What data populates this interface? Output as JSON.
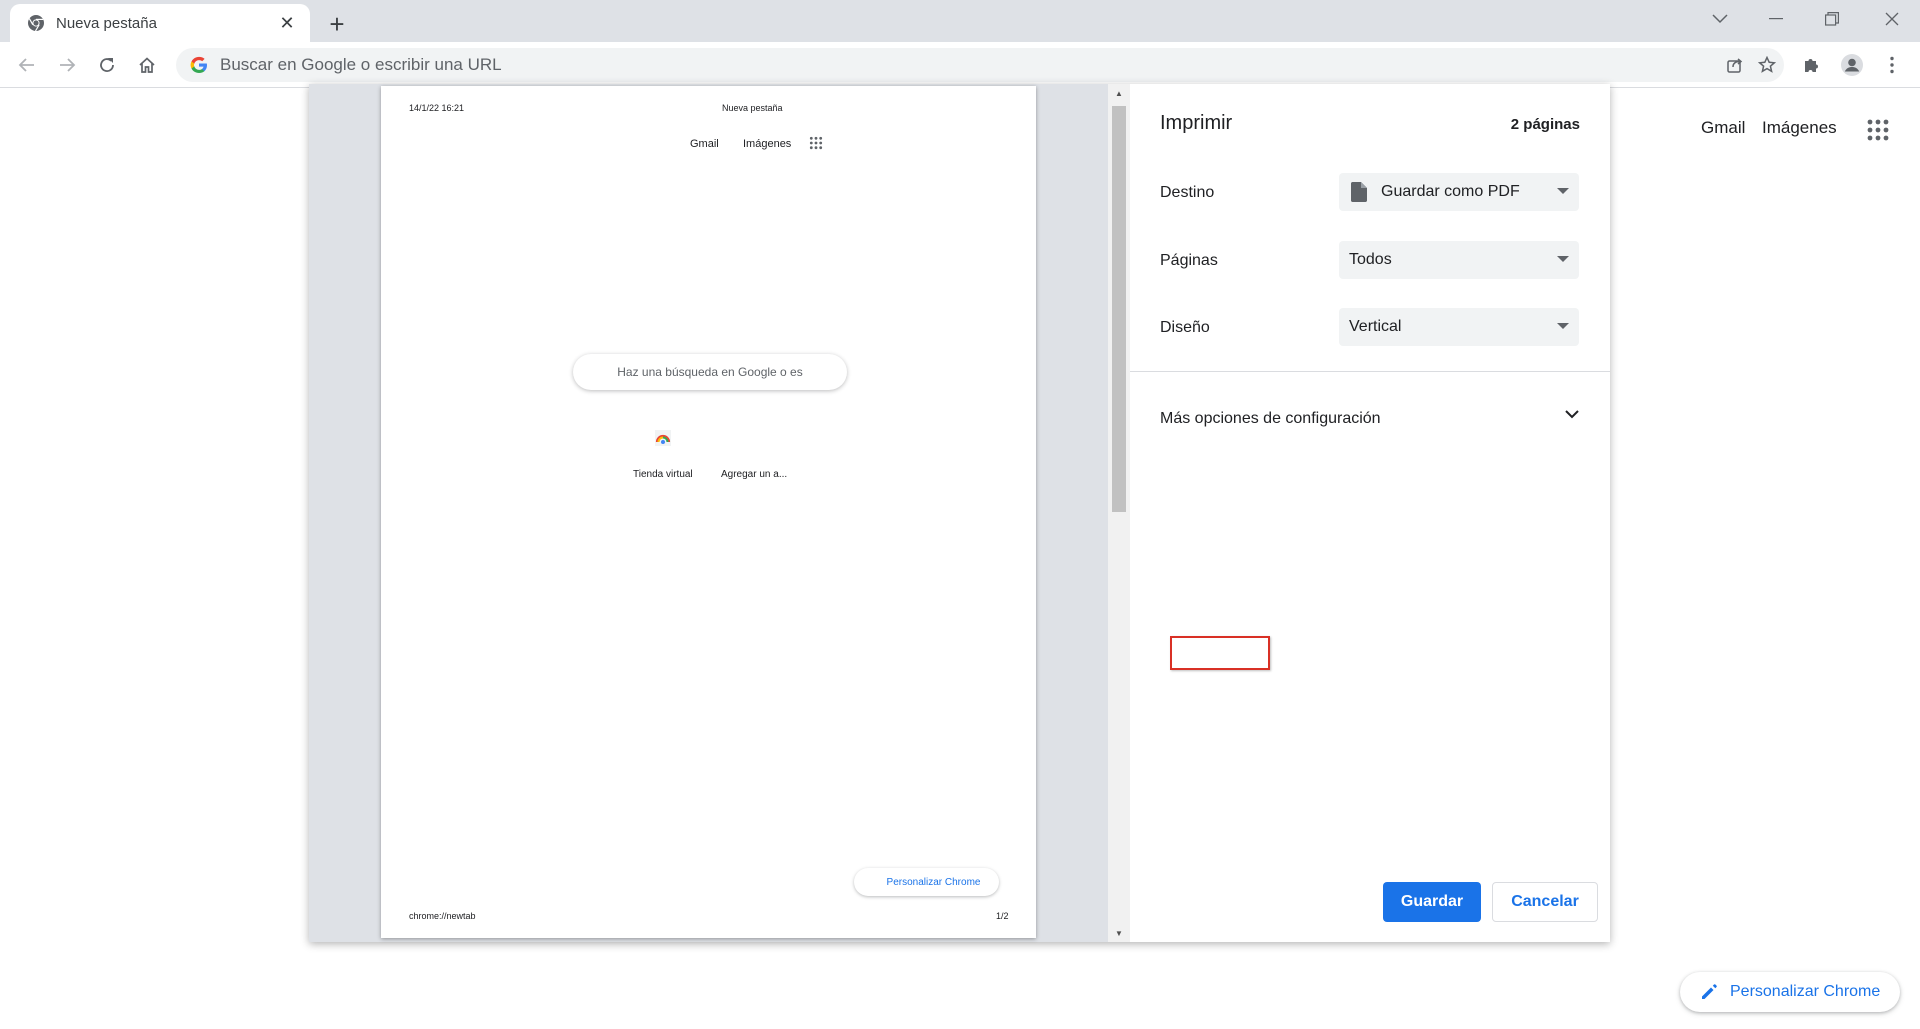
{
  "tab": {
    "title": "Nueva pestaña",
    "close_glyph": "✕",
    "new_tab_glyph": "+"
  },
  "omnibox": {
    "placeholder": "Buscar en Google o escribir una URL"
  },
  "background_page": {
    "gmail": "Gmail",
    "images": "Imágenes",
    "customize": "Personalizar Chrome"
  },
  "preview": {
    "header_date": "14/1/22 16:21",
    "header_title": "Nueva pestaña",
    "gmail": "Gmail",
    "images": "Imágenes",
    "search_placeholder": "Haz una búsqueda en Google o es",
    "shortcut_store": "Tienda virtual",
    "shortcut_add": "Agregar un a...",
    "customize": "Personalizar Chrome",
    "footer_url": "chrome://newtab",
    "footer_page": "1/2"
  },
  "print": {
    "title": "Imprimir",
    "page_count": "2 páginas",
    "destination_label": "Destino",
    "destination_value": "Guardar como PDF",
    "pages_label": "Páginas",
    "pages_value": "Todos",
    "layout_label": "Diseño",
    "layout_value": "Vertical",
    "more_options": "Más opciones de configuración",
    "save": "Guardar",
    "cancel": "Cancelar"
  },
  "colors": {
    "accent": "#1a73e8",
    "highlight_box": "#d93025",
    "tabstrip": "#dee1e6"
  }
}
